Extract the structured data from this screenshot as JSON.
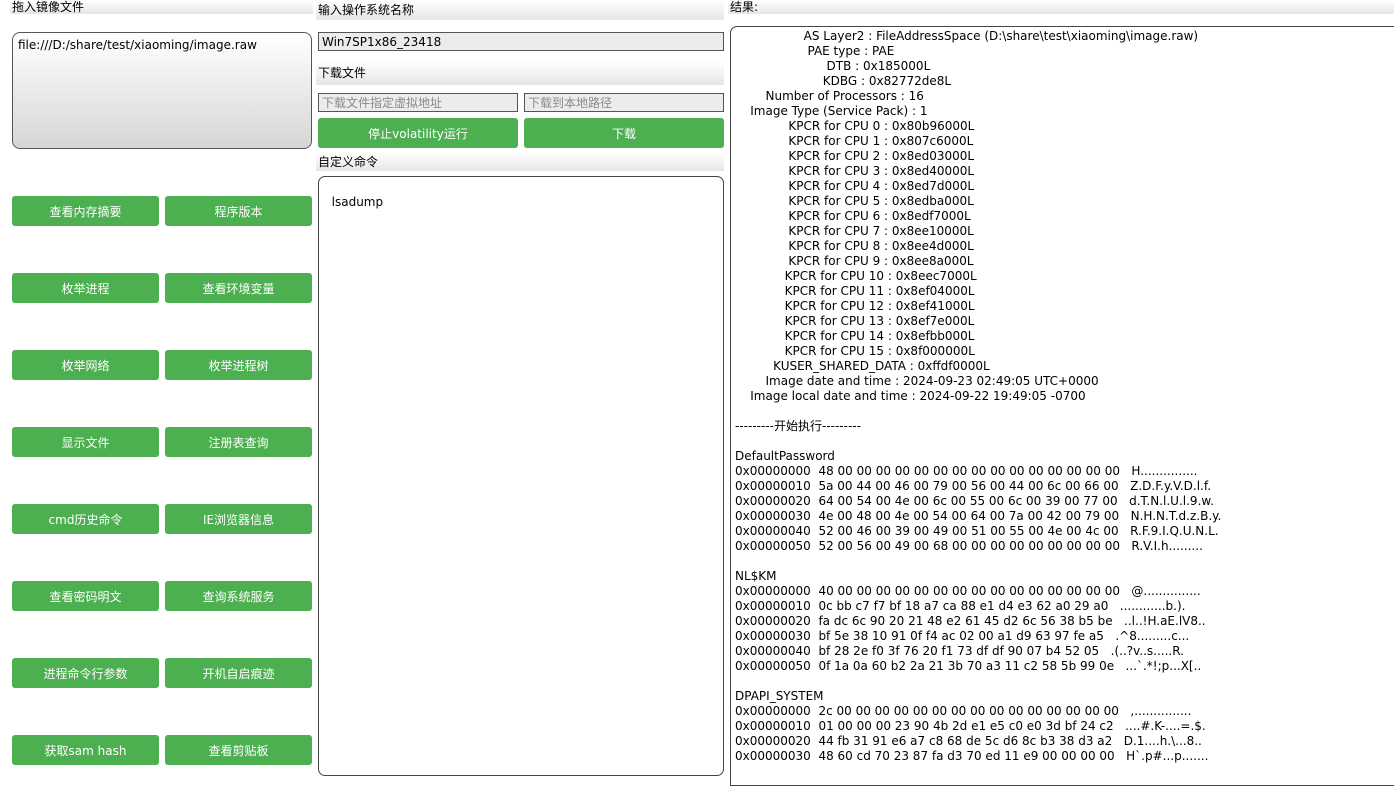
{
  "left": {
    "drop_title": "拖入镜像文件",
    "drop_path": "file:///D:/share/test/xiaoming/image.raw",
    "buttons": [
      "查看内存摘要",
      "程序版本",
      "枚举进程",
      "查看环境变量",
      "枚举网络",
      "枚举进程树",
      "显示文件",
      "注册表查询",
      "cmd历史命令",
      "IE浏览器信息",
      "查看密码明文",
      "查询系统服务",
      "进程命令行参数",
      "开机自启痕迹",
      "获取sam hash",
      "查看剪贴板"
    ]
  },
  "middle": {
    "os_title": "输入操作系统名称",
    "os_value": "Win7SP1x86_23418",
    "download_title": "下载文件",
    "download_virtual_placeholder": "下载文件指定虚拟地址",
    "download_local_placeholder": "下载到本地路径",
    "stop_button": "停止volatility运行",
    "download_button": "下载",
    "custom_title": "自定义命令",
    "custom_value": "lsadump"
  },
  "right": {
    "result_title": "结果:",
    "lines": [
      "                  AS Layer2 : FileAddressSpace (D:\\share\\test\\xiaoming\\image.raw)",
      "                   PAE type : PAE",
      "                        DTB : 0x185000L",
      "                       KDBG : 0x82772de8L",
      "        Number of Processors : 16",
      "    Image Type (Service Pack) : 1",
      "              KPCR for CPU 0 : 0x80b96000L",
      "              KPCR for CPU 1 : 0x807c6000L",
      "              KPCR for CPU 2 : 0x8ed03000L",
      "              KPCR for CPU 3 : 0x8ed40000L",
      "              KPCR for CPU 4 : 0x8ed7d000L",
      "              KPCR for CPU 5 : 0x8edba000L",
      "              KPCR for CPU 6 : 0x8edf7000L",
      "              KPCR for CPU 7 : 0x8ee10000L",
      "              KPCR for CPU 8 : 0x8ee4d000L",
      "              KPCR for CPU 9 : 0x8ee8a000L",
      "             KPCR for CPU 10 : 0x8eec7000L",
      "             KPCR for CPU 11 : 0x8ef04000L",
      "             KPCR for CPU 12 : 0x8ef41000L",
      "             KPCR for CPU 13 : 0x8ef7e000L",
      "             KPCR for CPU 14 : 0x8efbb000L",
      "             KPCR for CPU 15 : 0x8f000000L",
      "          KUSER_SHARED_DATA : 0xffdf0000L",
      "        Image date and time : 2024-09-23 02:49:05 UTC+0000",
      "    Image local date and time : 2024-09-22 19:49:05 -0700",
      "",
      "---------开始执行---------",
      "",
      "DefaultPassword",
      "0x00000000  48 00 00 00 00 00 00 00 00 00 00 00 00 00 00 00   H...............",
      "0x00000010  5a 00 44 00 46 00 79 00 56 00 44 00 6c 00 66 00   Z.D.F.y.V.D.l.f.",
      "0x00000020  64 00 54 00 4e 00 6c 00 55 00 6c 00 39 00 77 00   d.T.N.l.U.l.9.w.",
      "0x00000030  4e 00 48 00 4e 00 54 00 64 00 7a 00 42 00 79 00   N.H.N.T.d.z.B.y.",
      "0x00000040  52 00 46 00 39 00 49 00 51 00 55 00 4e 00 4c 00   R.F.9.I.Q.U.N.L.",
      "0x00000050  52 00 56 00 49 00 68 00 00 00 00 00 00 00 00 00   R.V.I.h.........",
      "",
      "NL$KM",
      "0x00000000  40 00 00 00 00 00 00 00 00 00 00 00 00 00 00 00   @...............",
      "0x00000010  0c bb c7 f7 bf 18 a7 ca 88 e1 d4 e3 62 a0 29 a0   ............b.).",
      "0x00000020  fa dc 6c 90 20 21 48 e2 61 45 d2 6c 56 38 b5 be   ..l..!H.aE.lV8..",
      "0x00000030  bf 5e 38 10 91 0f f4 ac 02 00 a1 d9 63 97 fe a5   .^8.........c...",
      "0x00000040  bf 28 2e f0 3f 76 20 f1 73 df df 90 07 b4 52 05   .(..?v..s.....R.",
      "0x00000050  0f 1a 0a 60 b2 2a 21 3b 70 a3 11 c2 58 5b 99 0e   ...`.*!;p...X[..",
      "",
      "DPAPI_SYSTEM",
      "0x00000000  2c 00 00 00 00 00 00 00 00 00 00 00 00 00 00 00   ,...............",
      "0x00000010  01 00 00 00 23 90 4b 2d e1 e5 c0 e0 3d bf 24 c2   ....#.K-....=.$.",
      "0x00000020  44 fb 31 91 e6 a7 c8 68 de 5c d6 8c b3 38 d3 a2   D.1....h.\\...8..",
      "0x00000030  48 60 cd 70 23 87 fa d3 70 ed 11 e9 00 00 00 00   H`.p#...p......."
    ]
  }
}
